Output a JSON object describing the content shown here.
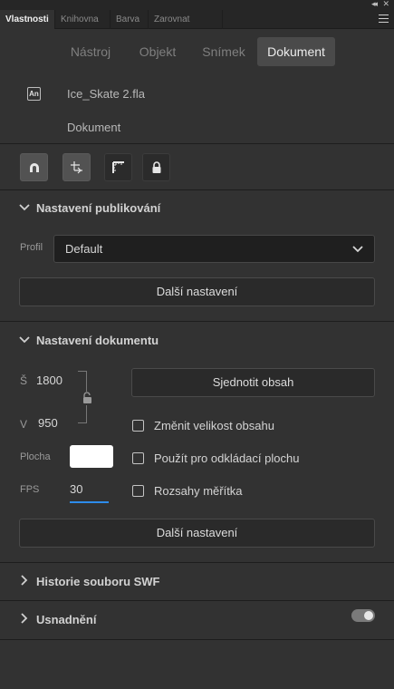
{
  "window": {
    "collapse_icon": "double-chevron-right-icon",
    "close_icon": "close-icon",
    "collapse_glyph": "◂◂",
    "close_glyph": "✕"
  },
  "tabs": [
    {
      "label": "Vlastnosti",
      "active": true
    },
    {
      "label": "Knihovna",
      "active": false
    },
    {
      "label": "Barva",
      "active": false
    },
    {
      "label": "Zarovnat",
      "active": false
    }
  ],
  "segments": [
    {
      "label": "Nástroj",
      "active": false
    },
    {
      "label": "Objekt",
      "active": false
    },
    {
      "label": "Snímek",
      "active": false
    },
    {
      "label": "Dokument",
      "active": true
    }
  ],
  "document": {
    "icon_text": "An",
    "filename": "Ice_Skate 2.fla",
    "type_label": "Dokument"
  },
  "tools": [
    {
      "icon": "magnet-icon",
      "active": true
    },
    {
      "icon": "snap-origin-icon",
      "active": true
    },
    {
      "icon": "ruler-icon",
      "active": false
    },
    {
      "icon": "lock-icon",
      "active": false
    }
  ],
  "publish": {
    "title": "Nastavení publikování",
    "profile_label": "Profil",
    "profile_value": "Default",
    "more_button": "Další nastavení"
  },
  "docsettings": {
    "title": "Nastavení dokumentu",
    "width_label": "Š",
    "width_value": "1800",
    "height_label": "V",
    "height_value": "950",
    "stage_label": "Plocha",
    "stage_color": "#ffffff",
    "fps_label": "FPS",
    "fps_value": "30",
    "match_button": "Sjednotit obsah",
    "checkboxes": [
      {
        "label": "Změnit velikost obsahu",
        "checked": false
      },
      {
        "label": "Použít pro odkládací plochu",
        "checked": false
      },
      {
        "label": "Rozsahy měřítka",
        "checked": false
      }
    ],
    "more_button": "Další nastavení"
  },
  "swf_history": {
    "title": "Historie souboru SWF"
  },
  "accessibility": {
    "title": "Usnadnění",
    "toggle_on": true
  },
  "colors": {
    "accent": "#2d8ceb",
    "panel_bg": "#323232",
    "active_segment": "#4a4a4a"
  }
}
